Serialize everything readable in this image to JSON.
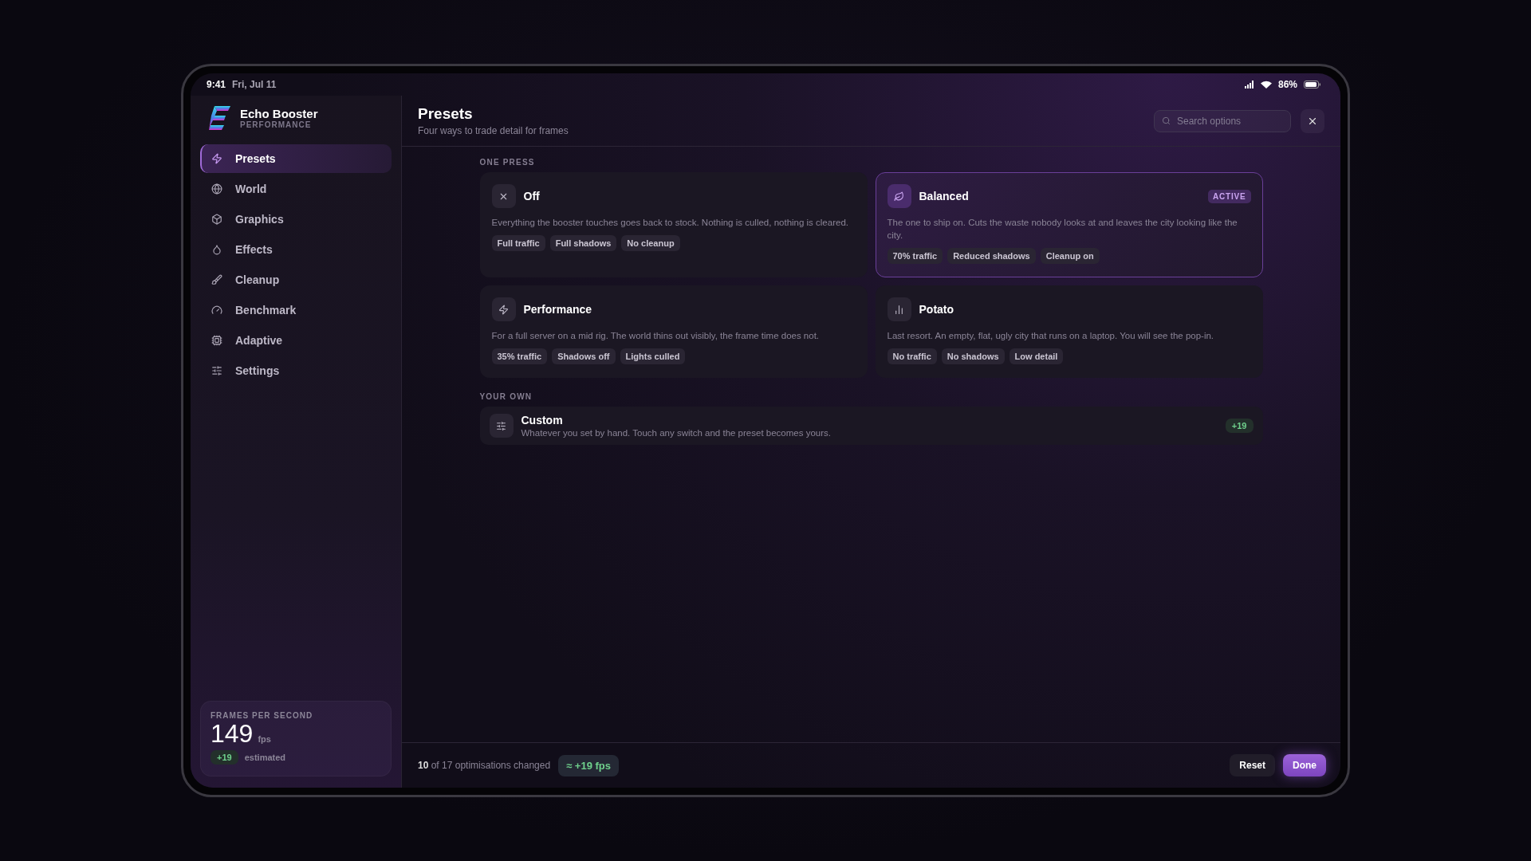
{
  "status_bar": {
    "time": "9:41",
    "date": "Fri, Jul 11",
    "battery": "86%"
  },
  "app": {
    "name": "Echo Booster",
    "subtitle": "PERFORMANCE"
  },
  "nav": [
    {
      "label": "Presets",
      "selected": true
    },
    {
      "label": "World",
      "selected": false
    },
    {
      "label": "Graphics",
      "selected": false
    },
    {
      "label": "Effects",
      "selected": false
    },
    {
      "label": "Cleanup",
      "selected": false
    },
    {
      "label": "Benchmark",
      "selected": false
    },
    {
      "label": "Adaptive",
      "selected": false
    },
    {
      "label": "Settings",
      "selected": false
    }
  ],
  "fps_card": {
    "label": "FRAMES PER SECOND",
    "value": "149",
    "unit": "fps",
    "delta": "+19",
    "note": "estimated"
  },
  "header": {
    "title": "Presets",
    "subtitle": "Four ways to trade detail for frames",
    "search": {
      "placeholder": "Search options"
    }
  },
  "one_press": {
    "title": "ONE PRESS",
    "presets": [
      {
        "name": "Off",
        "selected": false,
        "description": "Everything the booster touches goes back to stock. Nothing is culled, nothing is cleared.",
        "tags": [
          "Full traffic",
          "Full shadows",
          "No cleanup"
        ]
      },
      {
        "name": "Balanced",
        "selected": true,
        "badge": "ACTIVE",
        "description": "The one to ship on. Cuts the waste nobody looks at and leaves the city looking like the city.",
        "tags": [
          "70% traffic",
          "Reduced shadows",
          "Cleanup on"
        ]
      },
      {
        "name": "Performance",
        "selected": false,
        "description": "For a full server on a mid rig. The world thins out visibly, the frame time does not.",
        "tags": [
          "35% traffic",
          "Shadows off",
          "Lights culled"
        ]
      },
      {
        "name": "Potato",
        "selected": false,
        "description": "Last resort. An empty, flat, ugly city that runs on a laptop. You will see the pop-in.",
        "tags": [
          "No traffic",
          "No shadows",
          "Low detail"
        ]
      }
    ]
  },
  "your_own": {
    "title": "YOUR OWN",
    "custom": {
      "name": "Custom",
      "description": "Whatever you set by hand. Touch any switch and the preset becomes yours.",
      "delta": "+19"
    }
  },
  "footer": {
    "summary": "**10** of 17 optimisations changed",
    "fps": "≈ +19 fps",
    "buttons": [
      {
        "label": "Reset",
        "kind": "secondary"
      },
      {
        "label": "Done",
        "kind": "primary"
      }
    ]
  }
}
